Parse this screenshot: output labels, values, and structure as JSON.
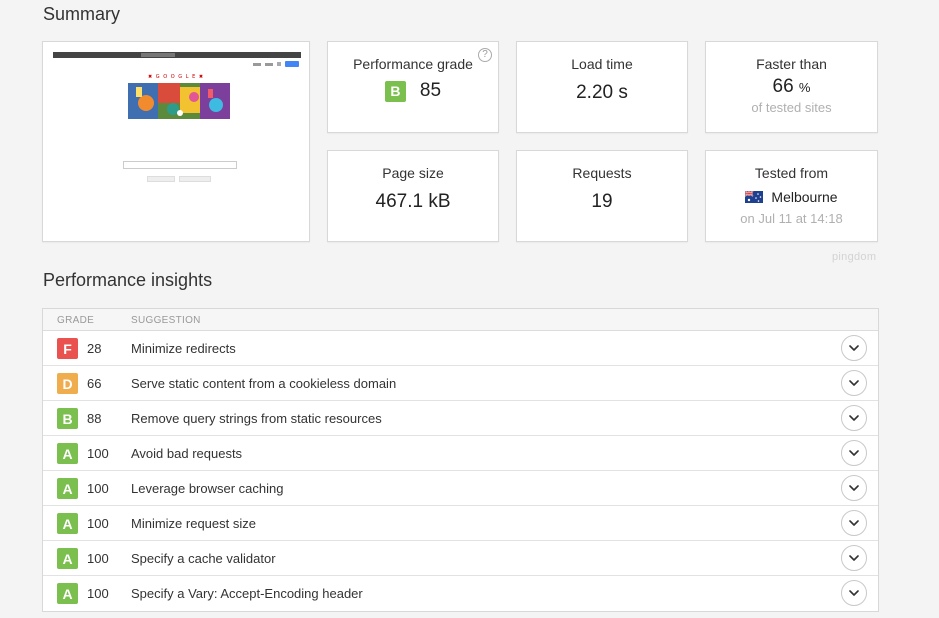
{
  "summary": {
    "title": "Summary",
    "performance_grade": {
      "label": "Performance grade",
      "grade": "B",
      "score": "85",
      "help": "?"
    },
    "load_time": {
      "label": "Load time",
      "value": "2.20 s"
    },
    "faster_than": {
      "label": "Faster than",
      "value": "66",
      "unit": "%",
      "sub": "of tested sites"
    },
    "page_size": {
      "label": "Page size",
      "value": "467.1 kB"
    },
    "requests": {
      "label": "Requests",
      "value": "19"
    },
    "tested_from": {
      "label": "Tested from",
      "location": "Melbourne",
      "date": "on Jul 11 at 14:18"
    },
    "preview_logo_text": "✖ G O O G L E ✖"
  },
  "brand": "pingdom",
  "insights": {
    "title": "Performance insights",
    "columns": {
      "grade": "GRADE",
      "suggestion": "SUGGESTION"
    },
    "rows": [
      {
        "grade": "F",
        "score": "28",
        "suggestion": "Minimize redirects"
      },
      {
        "grade": "D",
        "score": "66",
        "suggestion": "Serve static content from a cookieless domain"
      },
      {
        "grade": "B",
        "score": "88",
        "suggestion": "Remove query strings from static resources"
      },
      {
        "grade": "A",
        "score": "100",
        "suggestion": "Avoid bad requests"
      },
      {
        "grade": "A",
        "score": "100",
        "suggestion": "Leverage browser caching"
      },
      {
        "grade": "A",
        "score": "100",
        "suggestion": "Minimize request size"
      },
      {
        "grade": "A",
        "score": "100",
        "suggestion": "Specify a cache validator"
      },
      {
        "grade": "A",
        "score": "100",
        "suggestion": "Specify a Vary: Accept-Encoding header"
      }
    ]
  },
  "colors": {
    "grade_A": "#7bbf4e",
    "grade_B": "#7bbf4e",
    "grade_D": "#f0ad4e",
    "grade_F": "#e9524e"
  },
  "icons": {
    "expand": "chevron-down-icon",
    "flag": "australia-flag-icon",
    "help": "help-circle-icon"
  }
}
